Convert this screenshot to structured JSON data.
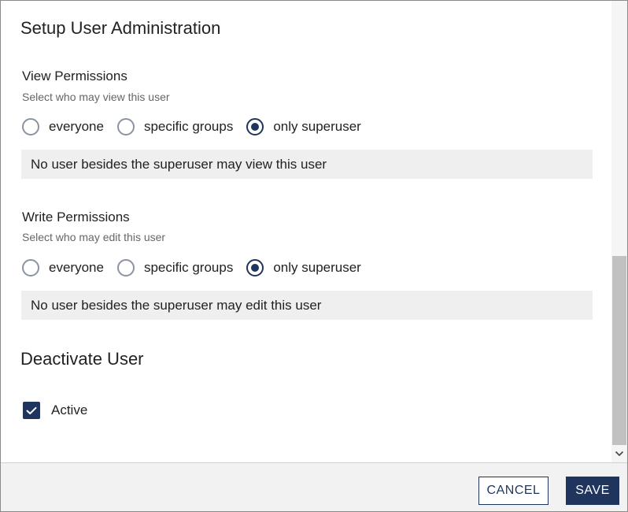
{
  "header": {
    "title": "Setup User Administration"
  },
  "view_permissions": {
    "title": "View Permissions",
    "hint": "Select who may view this user",
    "options": [
      {
        "label": "everyone",
        "selected": false
      },
      {
        "label": "specific groups",
        "selected": false
      },
      {
        "label": "only superuser",
        "selected": true
      }
    ],
    "info": "No user besides the superuser may view this user"
  },
  "write_permissions": {
    "title": "Write Permissions",
    "hint": "Select who may edit this user",
    "options": [
      {
        "label": "everyone",
        "selected": false
      },
      {
        "label": "specific groups",
        "selected": false
      },
      {
        "label": "only superuser",
        "selected": true
      }
    ],
    "info": "No user besides the superuser may edit this user"
  },
  "deactivate": {
    "title": "Deactivate User",
    "active_label": "Active",
    "active_checked": true
  },
  "footer": {
    "cancel_label": "CANCEL",
    "save_label": "SAVE"
  },
  "icons": {
    "checkbox": "check-icon",
    "scroll_down": "chevron-down-icon"
  },
  "colors": {
    "accent": "#1f355e",
    "info_bg": "#efefef",
    "footer_bg": "#f2f2f2"
  }
}
